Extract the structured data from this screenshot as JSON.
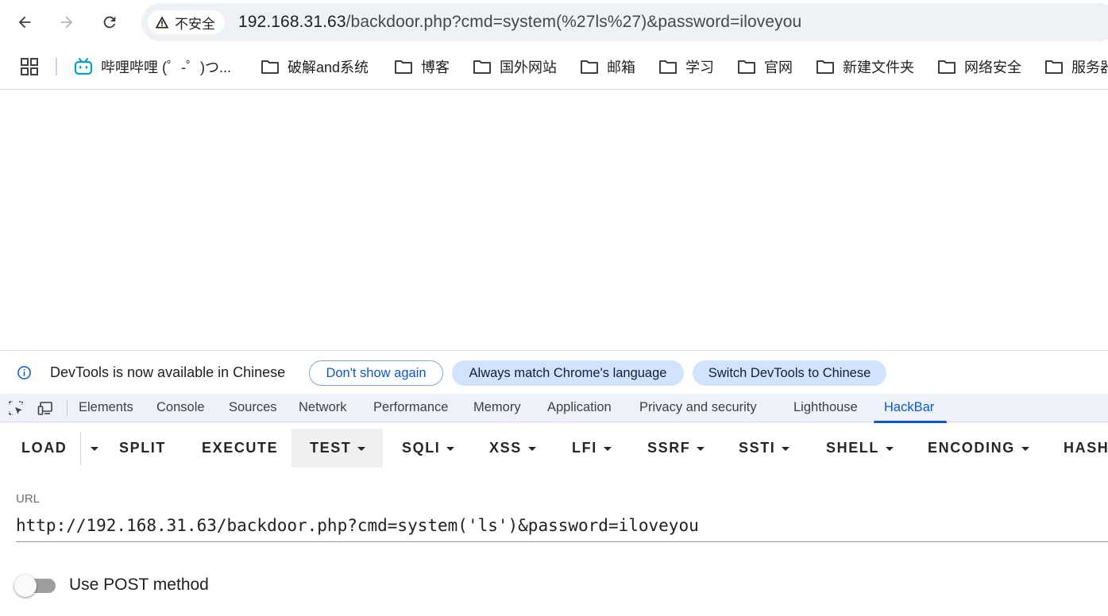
{
  "omnibox": {
    "security_label": "不安全",
    "url_host": "192.168.31.63",
    "url_rest": "/backdoor.php?cmd=system(%27ls%27)&password=iloveyou"
  },
  "bookmarks": [
    {
      "label": "哔哩哔哩 (゜-゜)つ...",
      "icon": "bilibili-icon"
    },
    {
      "label": "破解and系统",
      "icon": "folder-icon"
    },
    {
      "label": "博客",
      "icon": "folder-icon"
    },
    {
      "label": "国外网站",
      "icon": "folder-icon"
    },
    {
      "label": "邮箱",
      "icon": "folder-icon"
    },
    {
      "label": "学习",
      "icon": "folder-icon"
    },
    {
      "label": "官网",
      "icon": "folder-icon"
    },
    {
      "label": "新建文件夹",
      "icon": "folder-icon"
    },
    {
      "label": "网络安全",
      "icon": "folder-icon"
    },
    {
      "label": "服务器",
      "icon": "folder-icon"
    }
  ],
  "infobar": {
    "message": "DevTools is now available in Chinese",
    "dont_show": "Don't show again",
    "always_match": "Always match Chrome's language",
    "switch_chinese": "Switch DevTools to Chinese"
  },
  "devtools_tabs": [
    "Elements",
    "Console",
    "Sources",
    "Network",
    "Performance",
    "Memory",
    "Application",
    "Privacy and security",
    "Lighthouse",
    "HackBar"
  ],
  "active_tab": "HackBar",
  "hackbar": {
    "buttons": [
      "LOAD",
      "SPLIT",
      "EXECUTE",
      "TEST",
      "SQLI",
      "XSS",
      "LFI",
      "SSRF",
      "SSTI",
      "SHELL",
      "ENCODING",
      "HASH"
    ],
    "url_label": "URL",
    "url_value": "http://192.168.31.63/backdoor.php?cmd=system('ls')&password=iloveyou",
    "post_label": "Use POST method",
    "post_enabled": false
  },
  "colors": {
    "accent": "#0b57d0",
    "omnibox_bg": "#eef1f6",
    "pill_bg": "#d3e3fd",
    "tabbar_bg": "#eef2f8"
  }
}
